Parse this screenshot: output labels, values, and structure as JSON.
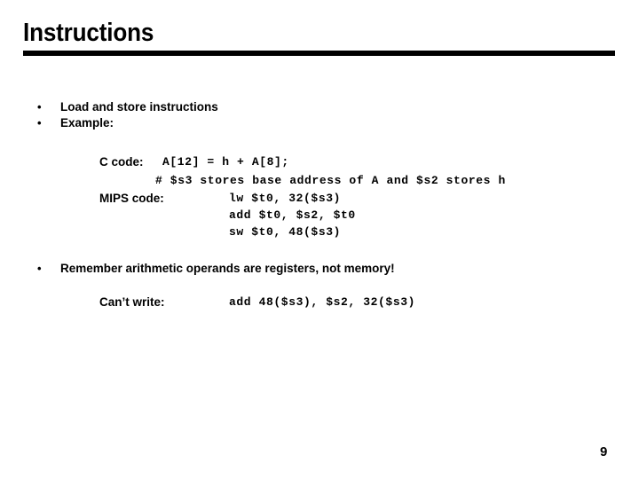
{
  "slide": {
    "title": "Instructions",
    "page_number": "9",
    "accent_color": "#000000",
    "background_color": "#ffffff"
  },
  "bullets": [
    {
      "marker": "•",
      "text": "Load and store instructions"
    },
    {
      "marker": "•",
      "text": "Example:"
    },
    {
      "marker": "•",
      "text": "Remember arithmetic operands are registers, not memory!"
    }
  ],
  "example": {
    "c_label": "C code:",
    "c_code": "A[12] = h + A[8];",
    "comment": "# $s3 stores base address of A and $s2 stores h",
    "mips_label": "MIPS code:",
    "mips_lines": [
      "lw $t0, 32($s3)",
      "add $t0, $s2, $t0",
      "sw $t0, 48($s3)"
    ]
  },
  "counter_example": {
    "label": "Can’t write:",
    "code": "add 48($s3), $s2, 32($s3)"
  }
}
